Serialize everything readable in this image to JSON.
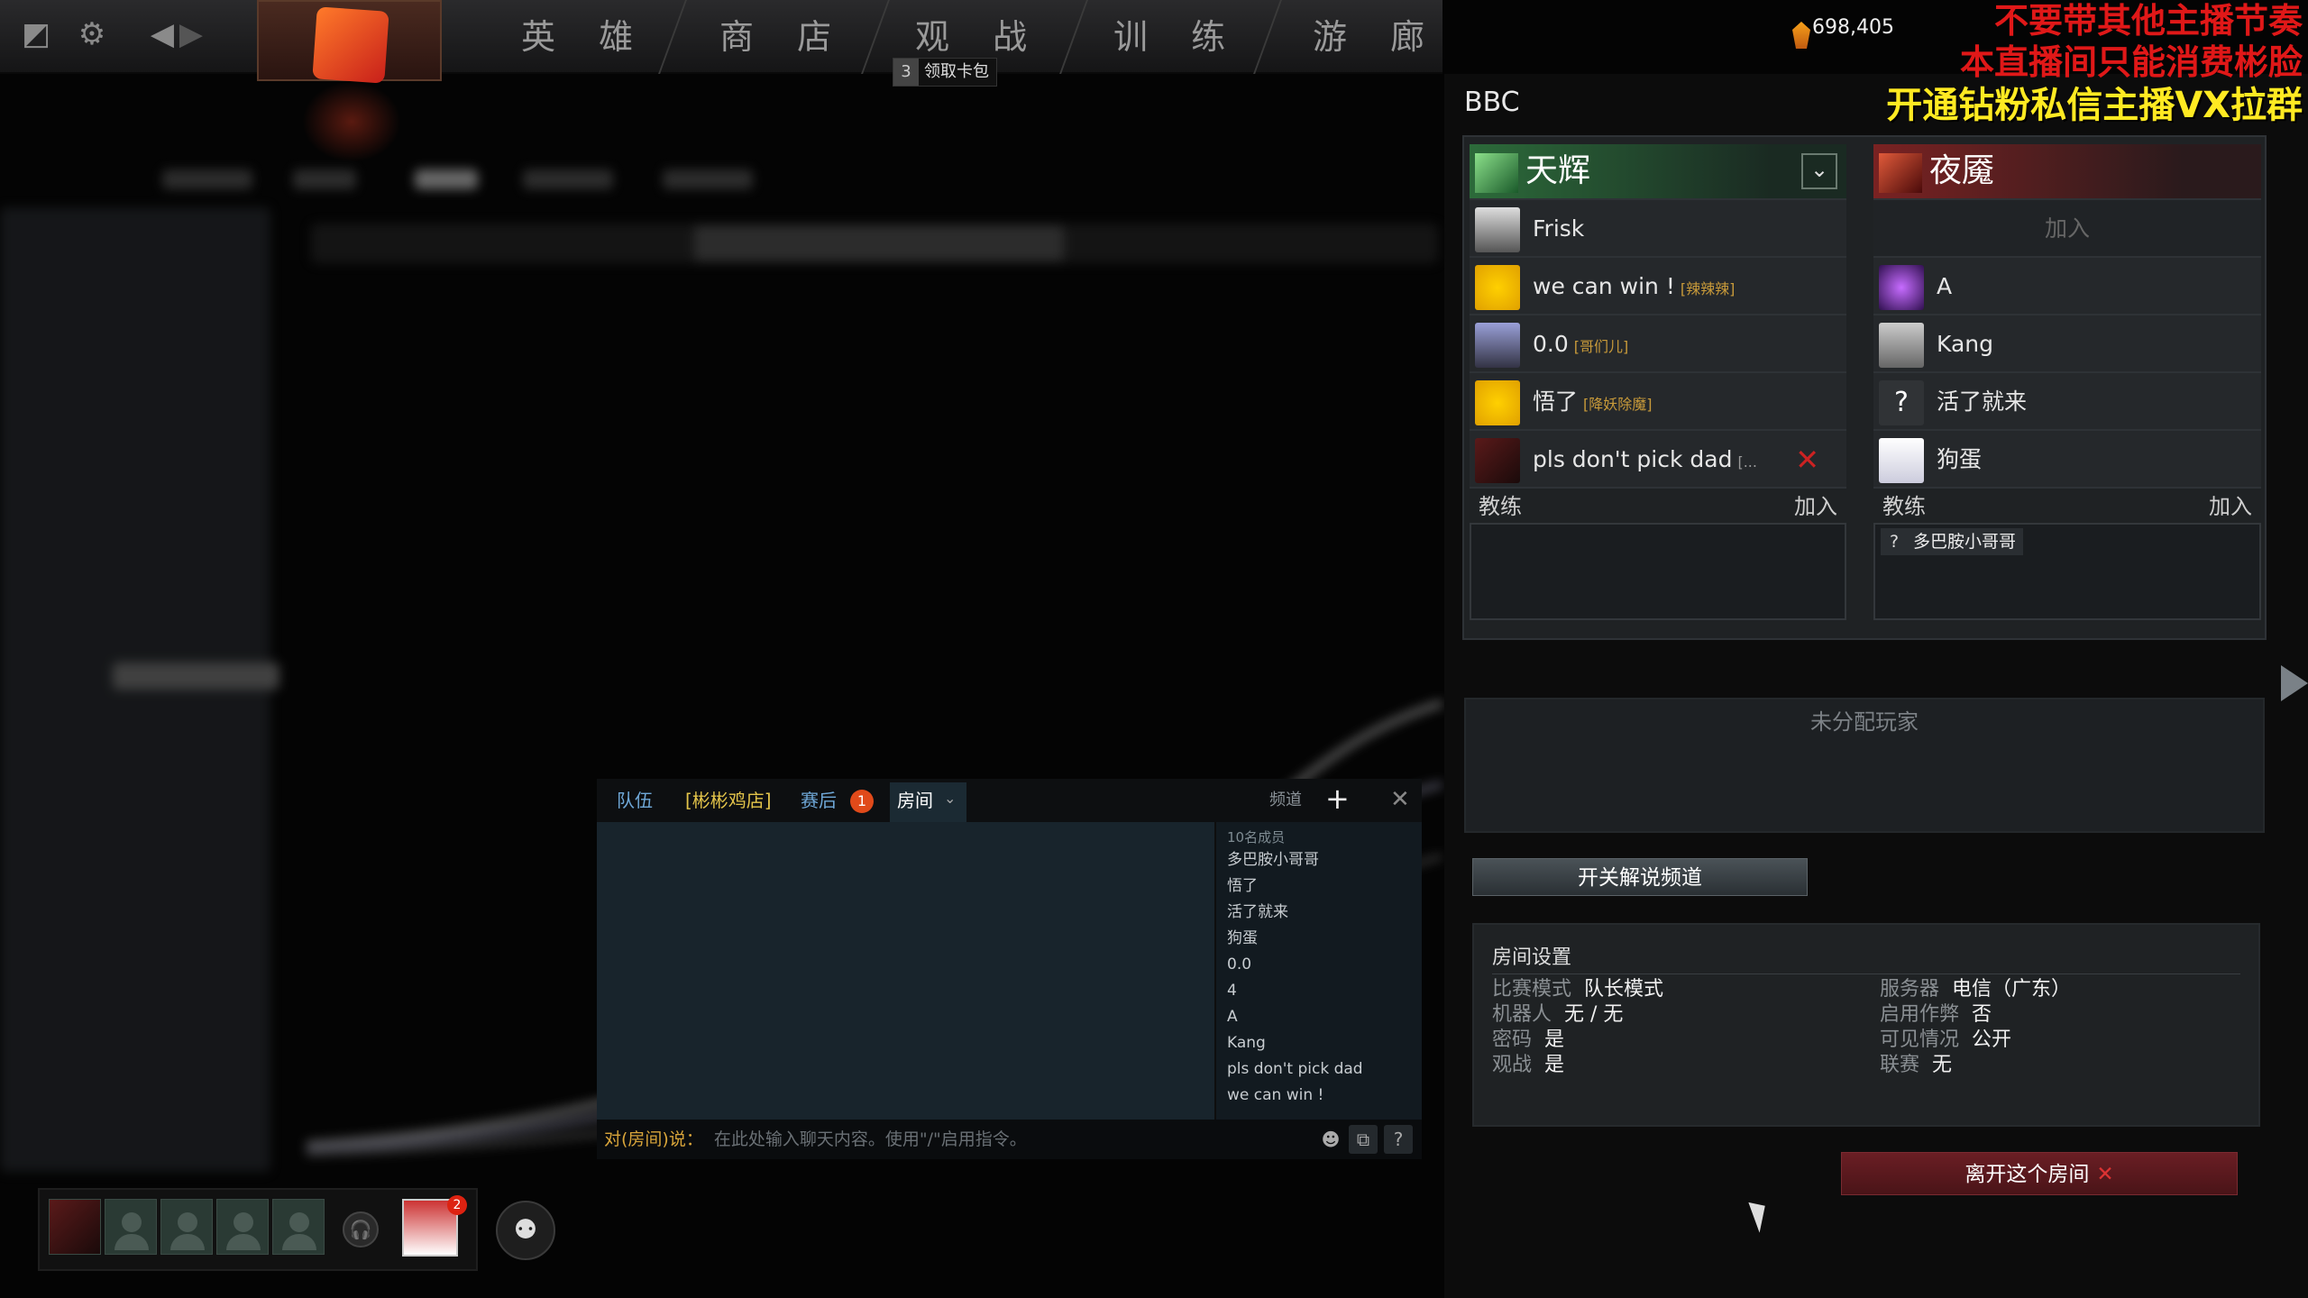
{
  "nav": {
    "items": [
      "英 雄",
      "商 店",
      "观 战",
      "训 练",
      "游 廊"
    ],
    "tooltip_num": "3",
    "tooltip_text": "领取卡包"
  },
  "currency": {
    "amount": "698,405"
  },
  "overlay": {
    "line1": "不要带其他主播节奏",
    "line2": "本直播间只能消费彬脸",
    "line3": "开通钻粉私信主播VX拉群"
  },
  "lobby": {
    "title": "BBC"
  },
  "radiant": {
    "name": "天辉",
    "players": [
      {
        "name": "Frisk",
        "tag": ""
      },
      {
        "name": "we can win !",
        "tag": "[辣辣辣]"
      },
      {
        "name": "0.0",
        "tag": "[哥们儿]"
      },
      {
        "name": "悟了",
        "tag": "[降妖除魔]"
      },
      {
        "name": "pls don't pick dad",
        "tag": "[..."
      }
    ],
    "coach_label": "教练",
    "coach_join": "加入"
  },
  "dire": {
    "name": "夜魇",
    "join_label": "加入",
    "players": [
      {
        "name": "A"
      },
      {
        "name": "Kang"
      },
      {
        "name": "活了就来"
      },
      {
        "name": "狗蛋"
      }
    ],
    "coach_label": "教练",
    "coach_join": "加入",
    "coach_name": "多巴胺小哥哥",
    "coach_icon": "?"
  },
  "unassigned": {
    "label": "未分配玩家"
  },
  "caster_button": "开关解说频道",
  "settings": {
    "title": "房间设置",
    "left": [
      {
        "k": "比赛模式",
        "v": "队长模式"
      },
      {
        "k": "机器人",
        "v": "无 / 无"
      },
      {
        "k": "密码",
        "v": "是"
      },
      {
        "k": "观战",
        "v": "是"
      }
    ],
    "right": [
      {
        "k": "服务器",
        "v": "电信（广东）"
      },
      {
        "k": "启用作弊",
        "v": "否"
      },
      {
        "k": "可见情况",
        "v": "公开"
      },
      {
        "k": "联赛",
        "v": "无"
      }
    ]
  },
  "leave_button": "离开这个房间",
  "chat": {
    "tabs": [
      "队伍",
      "[彬彬鸡店]",
      "赛后",
      "房间"
    ],
    "postgame_badge": "1",
    "channel_label": "频道",
    "member_count": "10名成员",
    "members": [
      "多巴胺小哥哥",
      "悟了",
      "活了就来",
      "狗蛋",
      "0.0",
      "4",
      "A",
      "Kang",
      "pls don't pick dad",
      "we can win !"
    ],
    "input_prefix": "对(房间)说：",
    "input_placeholder": "在此处输入聊天内容。使用\"/\"启用指令。"
  },
  "party": {
    "notification_badge": "2"
  },
  "colors": {
    "radiant": "#2c6b3a",
    "dire": "#7a2222",
    "accent_gold": "#d9a53a",
    "overlay_red": "#e01818",
    "overlay_yellow": "#ffea22"
  }
}
